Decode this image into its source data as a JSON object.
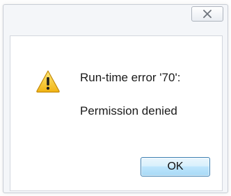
{
  "dialog": {
    "close_icon": "close-icon",
    "warning_icon": "warning-icon",
    "message_title": "Run-time error '70':",
    "message_body": "Permission denied",
    "ok_label": "OK",
    "colors": {
      "warning_yellow": "#f2c21a",
      "ok_border": "#3c7fb1"
    }
  }
}
